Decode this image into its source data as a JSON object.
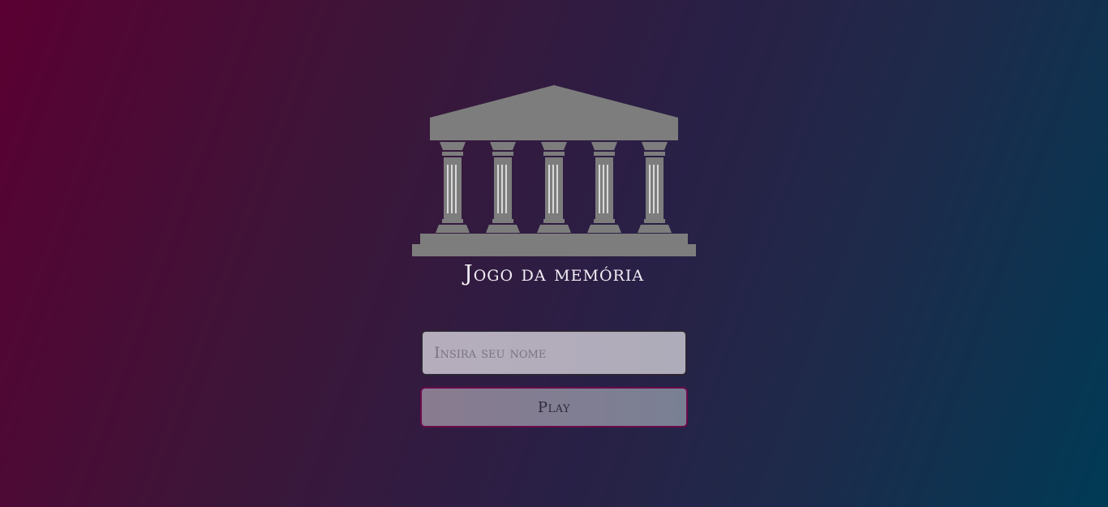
{
  "app": {
    "title": "Jogo da memória",
    "logo_icon": "temple-icon"
  },
  "login": {
    "name_placeholder": "Insira seu nome",
    "name_value": "",
    "play_label": "Play"
  },
  "colors": {
    "background_start": "#5a0032",
    "background_end": "#003a55",
    "logo_gray": "#7d7d7d",
    "title_text": "#f2eef5",
    "button_border": "#6a0a4a"
  }
}
